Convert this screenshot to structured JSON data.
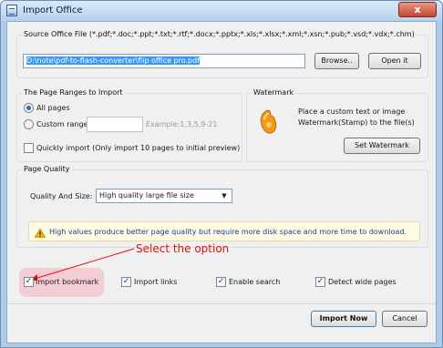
{
  "window": {
    "title": "Import Office",
    "close_glyph": "x"
  },
  "source": {
    "group_label": "Source Office File (*.pdf;*.doc;*.ppt;*.txt;*.rtf;*.docx;*.pptx;*.xls;*.xlsx;*.xml;*.xsn;*.pub;*.vsd;*.vdx;*.chm)",
    "path_value": "D:\\note\\pdf-to-flash-converter\\flip office pro.pdf",
    "browse_label": "Browse..",
    "open_label": "Open it"
  },
  "page_ranges": {
    "group_label": "The Page Ranges to Import",
    "all_pages_label": "All pages",
    "custom_range_label": "Custom range:",
    "custom_range_value": "",
    "custom_range_example": "Example:1,3,5,9-21",
    "quick_import_label": "Quickly import (Only import 10 pages to  initial  preview)",
    "selected": "all_pages"
  },
  "watermark": {
    "group_label": "Watermark",
    "description_line1": "Place a custom text or image",
    "description_line2": "Watermark(Stamp) to the file(s)",
    "button_label": "Set Watermark",
    "icon": "hand-stamp-icon"
  },
  "page_quality": {
    "group_label": "Page Quality",
    "quality_label": "Quality And Size:",
    "quality_value": "High quality large file size",
    "info_text": "High values produce better page quality but require more disk space and more time to download.",
    "info_icon": "warning-icon"
  },
  "annotation": {
    "text": "Select the option",
    "color": "#e01010"
  },
  "options": {
    "import_bookmark": {
      "label": "Import bookmark",
      "checked": true
    },
    "import_links": {
      "label": "Import links",
      "checked": true
    },
    "enable_search": {
      "label": "Enable search",
      "checked": true
    },
    "detect_wide_pages": {
      "label": "Detect wide pages",
      "checked": true
    },
    "check_glyph": "✓"
  },
  "footer": {
    "import_now_label": "Import Now",
    "cancel_label": "Cancel"
  },
  "colors": {
    "title_bar": "#b6d1ec",
    "selection": "#3399ff",
    "annotation_red": "#e01010",
    "highlight_pink": "#f4c8cf",
    "info_bar_bg": "#fffbe3",
    "info_text": "#1f3f8f"
  }
}
